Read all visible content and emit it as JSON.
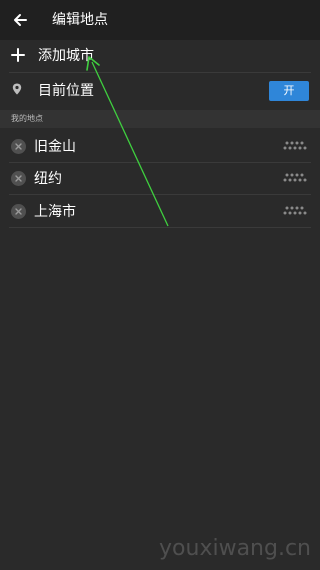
{
  "header": {
    "title": "编辑地点",
    "back_icon": "arrow-left-icon"
  },
  "actions": {
    "add_city_label": "添加城市",
    "add_icon": "plus-icon"
  },
  "current_location": {
    "label": "目前位置",
    "toggle_label": "开",
    "enabled": true,
    "icon": "location-pin-icon"
  },
  "section": {
    "label": "我的地点"
  },
  "cities": [
    {
      "name": "旧金山"
    },
    {
      "name": "纽约"
    },
    {
      "name": "上海市"
    }
  ],
  "watermark": "youxiwang.cn",
  "colors": {
    "background": "#2a2a2a",
    "appbar": "#202020",
    "accent": "#2f86d9",
    "annotation_arrow": "#3fcf3f"
  }
}
